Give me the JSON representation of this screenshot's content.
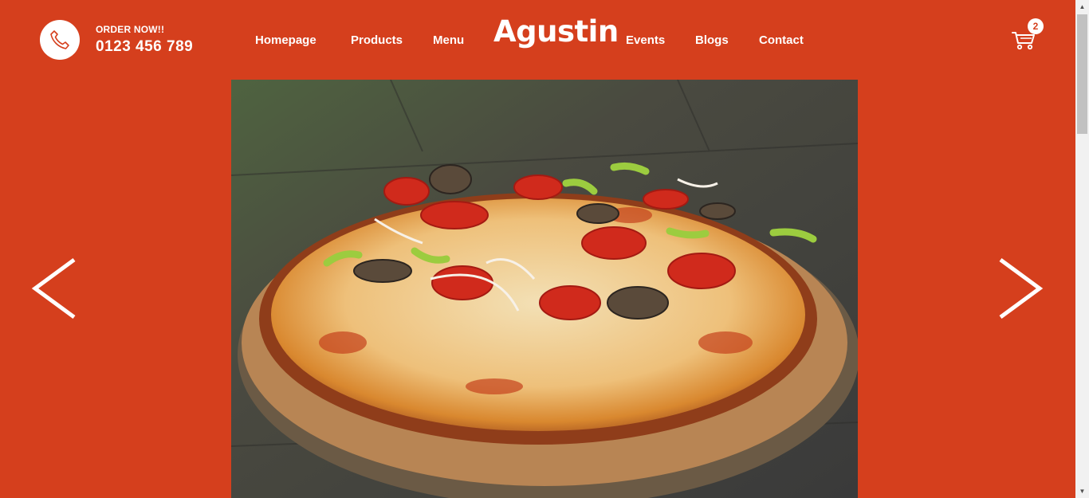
{
  "header": {
    "order_label": "ORDER NOW!!",
    "order_phone": "0123 456 789",
    "logo": "Agustin",
    "nav": {
      "homepage": "Homepage",
      "products": "Products",
      "menu": "Menu",
      "events": "Events",
      "blogs": "Blogs",
      "contact": "Contact"
    },
    "cart_count": "2"
  },
  "slider": {
    "image": "pizza-image"
  },
  "colors": {
    "background": "#d53f1d",
    "text": "#ffffff"
  }
}
